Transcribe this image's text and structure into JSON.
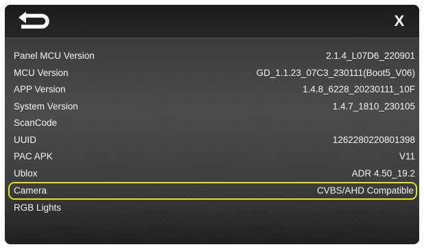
{
  "header": {
    "back_icon": "return-arrow-icon",
    "close_label": "X"
  },
  "highlight_color": "#e9e21a",
  "rows": [
    {
      "label": "Panel MCU Version",
      "value": "2.1.4_L07D6_220901"
    },
    {
      "label": "MCU Version",
      "value": "GD_1.1.23_07C3_230111(Boot5_V06)"
    },
    {
      "label": "APP Version",
      "value": "1.4.8_6228_20230111_10F"
    },
    {
      "label": "System Version",
      "value": "1.4.7_1810_230105"
    },
    {
      "label": "ScanCode",
      "value": ""
    },
    {
      "label": "UUID",
      "value": "1262280220801398"
    },
    {
      "label": "PAC APK",
      "value": "V11"
    },
    {
      "label": "Ublox",
      "value": "ADR 4.50_19.2"
    },
    {
      "label": "Camera",
      "value": "CVBS/AHD Compatible",
      "highlighted": true
    },
    {
      "label": "RGB Lights",
      "value": ""
    }
  ]
}
